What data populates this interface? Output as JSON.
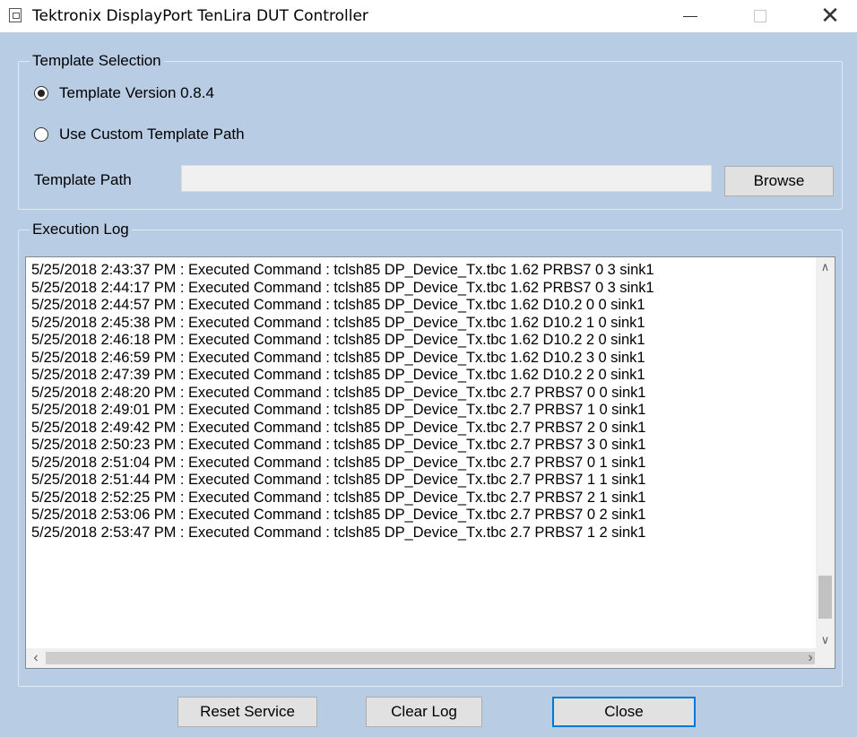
{
  "window": {
    "title": "Tektronix DisplayPort TenLira DUT Controller",
    "min_glyph": "",
    "close_glyph": "✕"
  },
  "template_selection": {
    "legend": "Template Selection",
    "option_version": "Template Version 0.8.4",
    "option_custom": "Use Custom Template Path",
    "selected": "option_version",
    "path_label": "Template Path",
    "path_value": "",
    "browse_label": "Browse"
  },
  "execution_log": {
    "legend": "Execution Log",
    "lines": [
      "5/25/2018 2:43:37 PM : Executed Command : tclsh85 DP_Device_Tx.tbc 1.62 PRBS7 0 3 sink1",
      "5/25/2018 2:44:17 PM : Executed Command : tclsh85 DP_Device_Tx.tbc 1.62 PRBS7 0 3 sink1",
      "5/25/2018 2:44:57 PM : Executed Command : tclsh85 DP_Device_Tx.tbc 1.62 D10.2 0 0 sink1",
      "5/25/2018 2:45:38 PM : Executed Command : tclsh85 DP_Device_Tx.tbc 1.62 D10.2 1 0 sink1",
      "5/25/2018 2:46:18 PM : Executed Command : tclsh85 DP_Device_Tx.tbc 1.62 D10.2 2 0 sink1",
      "5/25/2018 2:46:59 PM : Executed Command : tclsh85 DP_Device_Tx.tbc 1.62 D10.2 3 0 sink1",
      "5/25/2018 2:47:39 PM : Executed Command : tclsh85 DP_Device_Tx.tbc 1.62 D10.2 2 0 sink1",
      "5/25/2018 2:48:20 PM : Executed Command : tclsh85 DP_Device_Tx.tbc 2.7 PRBS7 0 0 sink1",
      "5/25/2018 2:49:01 PM : Executed Command : tclsh85 DP_Device_Tx.tbc 2.7 PRBS7 1 0 sink1",
      "5/25/2018 2:49:42 PM : Executed Command : tclsh85 DP_Device_Tx.tbc 2.7 PRBS7 2 0 sink1",
      "5/25/2018 2:50:23 PM : Executed Command : tclsh85 DP_Device_Tx.tbc 2.7 PRBS7 3 0 sink1",
      "5/25/2018 2:51:04 PM : Executed Command : tclsh85 DP_Device_Tx.tbc 2.7 PRBS7 0 1 sink1",
      "5/25/2018 2:51:44 PM : Executed Command : tclsh85 DP_Device_Tx.tbc 2.7 PRBS7 1 1 sink1",
      "5/25/2018 2:52:25 PM : Executed Command : tclsh85 DP_Device_Tx.tbc 2.7 PRBS7 2 1 sink1",
      "5/25/2018 2:53:06 PM : Executed Command : tclsh85 DP_Device_Tx.tbc 2.7 PRBS7 0 2 sink1",
      "5/25/2018 2:53:47 PM : Executed Command : tclsh85 DP_Device_Tx.tbc 2.7 PRBS7 1 2 sink1"
    ]
  },
  "buttons": {
    "reset": "Reset Service",
    "clear": "Clear Log",
    "close": "Close"
  },
  "colors": {
    "client_bg": "#b8cce4",
    "focus_border": "#0078d7"
  }
}
